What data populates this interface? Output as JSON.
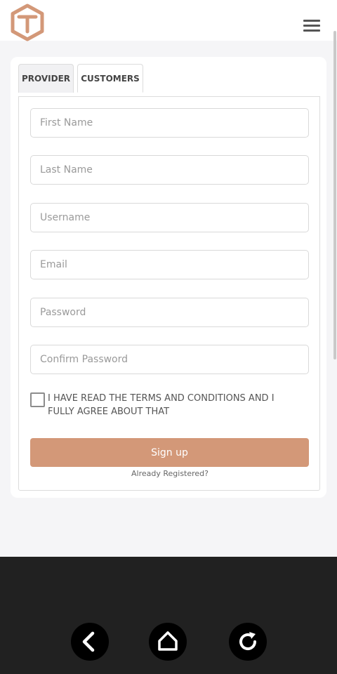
{
  "header": {
    "logo_icon": "hexagon-T-logo-icon",
    "menu_icon": "hamburger-menu-icon",
    "brand_color": "#d39878"
  },
  "tabs": [
    {
      "label": "PROVIDER",
      "active": false
    },
    {
      "label": "CUSTOMERS",
      "active": true
    }
  ],
  "form": {
    "first_name_placeholder": "First Name",
    "last_name_placeholder": "Last Name",
    "username_placeholder": "Username",
    "email_placeholder": "Email",
    "password_placeholder": "Password",
    "confirm_password_placeholder": "Confirm Password",
    "terms_text": "I HAVE READ THE TERMS AND CONDITIONS AND I FULLY AGREE ABOUT THAT",
    "terms_checked": false,
    "signup_label": "Sign up",
    "already_registered_label": "Already Registered?"
  },
  "navigation": {
    "back_icon": "chevron-left-icon",
    "home_icon": "home-icon",
    "refresh_icon": "refresh-icon"
  }
}
